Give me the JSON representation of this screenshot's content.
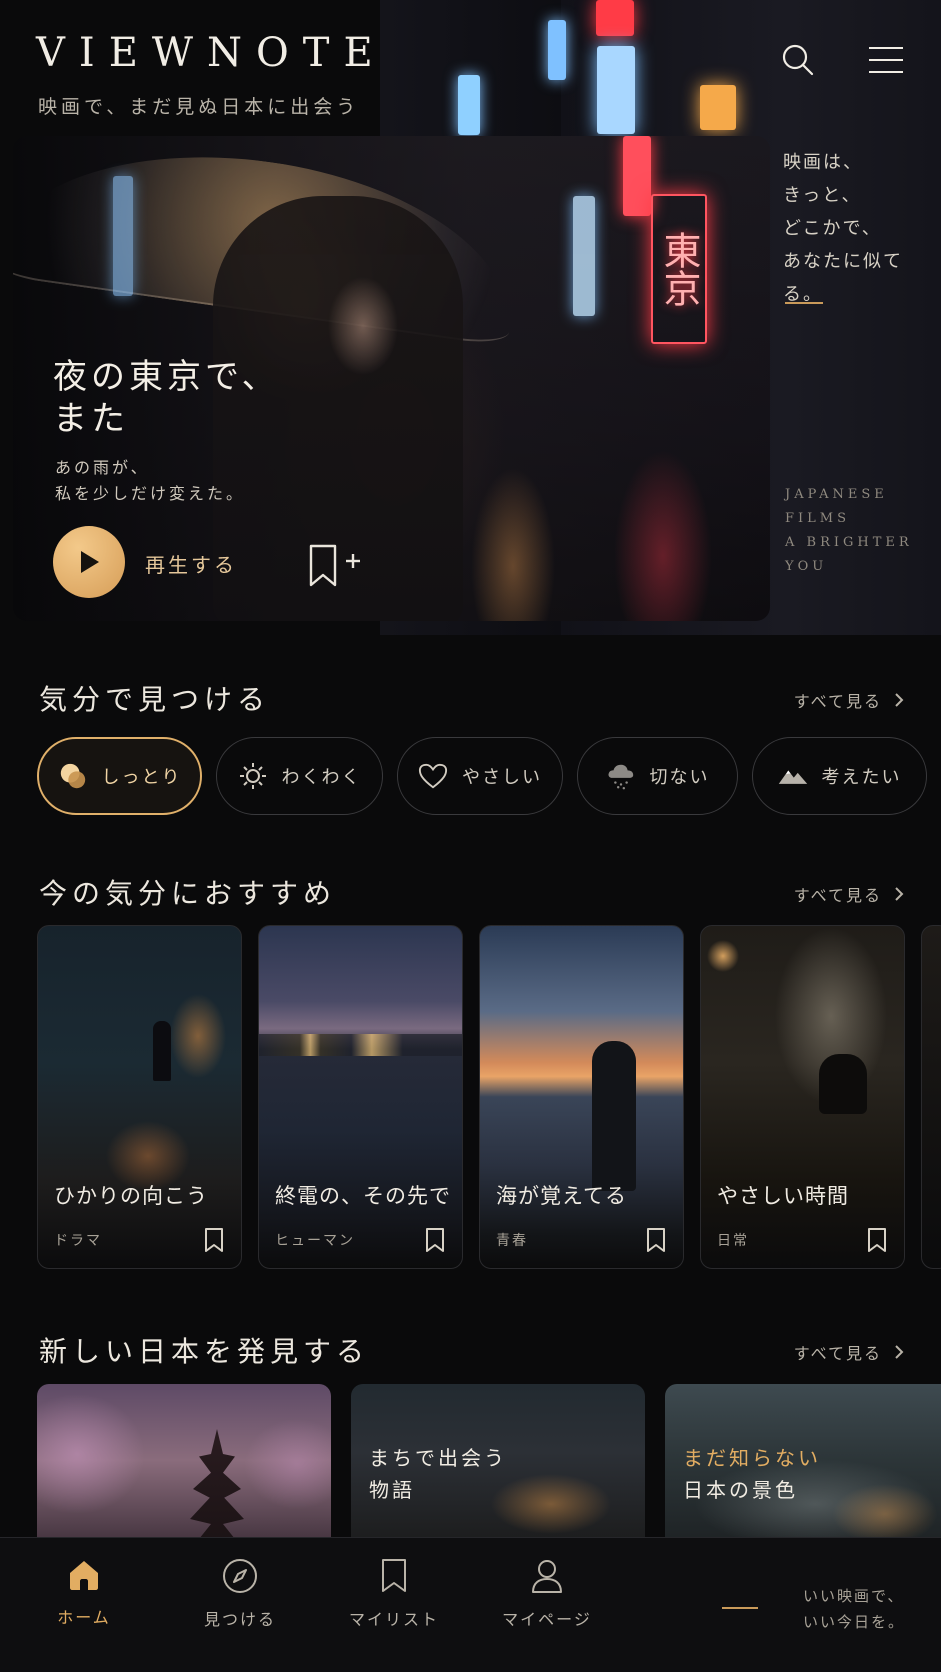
{
  "app": {
    "brand": "VIEWNOTE",
    "tagline": "映画で、まだ見ぬ日本に出会う"
  },
  "hero": {
    "side_quote": [
      "映画は、",
      "きっと、",
      "どこかで、",
      "あなたに似てる。"
    ],
    "side_english": [
      "JAPANESE",
      "FILMS",
      "A BRIGHTER",
      "YOU"
    ],
    "title_line1": "夜の東京で、",
    "title_line2": "また",
    "subtitle_line1": "あの雨が、",
    "subtitle_line2": "私を少しだけ変えた。",
    "play_label": "再生する",
    "neon_sign": "東京",
    "slides": 5,
    "active_slide": 1
  },
  "mood_section": {
    "title": "気分で見つける",
    "see_all": "すべて見る",
    "chips": [
      {
        "label": "しっとり",
        "icon": "moon-drops-icon",
        "active": true
      },
      {
        "label": "わくわく",
        "icon": "sun-icon",
        "active": false
      },
      {
        "label": "やさしい",
        "icon": "heart-icon",
        "active": false
      },
      {
        "label": "切ない",
        "icon": "rain-cloud-icon",
        "active": false
      },
      {
        "label": "考えたい",
        "icon": "mountain-icon",
        "active": false
      }
    ]
  },
  "recommend_section": {
    "title": "今の気分におすすめ",
    "see_all": "すべて見る",
    "cards": [
      {
        "title": "ひかりの向こう",
        "genre": "ドラマ"
      },
      {
        "title": "終電の、その先で",
        "genre": "ヒューマン"
      },
      {
        "title": "海が覚えてる",
        "genre": "青春"
      },
      {
        "title": "やさしい時間",
        "genre": "日常"
      }
    ]
  },
  "discover_section": {
    "title": "新しい日本を発見する",
    "see_all": "すべて見る",
    "cards": [
      {
        "text_line1": "",
        "text_line2": ""
      },
      {
        "text_line1": "まちで出会う",
        "text_line2": "物語"
      },
      {
        "text_line1": "まだ知らない",
        "text_line2": "日本の景色"
      }
    ]
  },
  "bottom_nav": {
    "items": [
      {
        "label": "ホーム",
        "icon": "home-icon",
        "active": true
      },
      {
        "label": "見つける",
        "icon": "compass-icon",
        "active": false
      },
      {
        "label": "マイリスト",
        "icon": "bookmark-icon",
        "active": false
      },
      {
        "label": "マイページ",
        "icon": "user-icon",
        "active": false
      }
    ],
    "quote_line1": "いい映画で、",
    "quote_line2": "いい今日を。"
  },
  "colors": {
    "accent": "#e2ad62",
    "background": "#0a0a0b"
  }
}
